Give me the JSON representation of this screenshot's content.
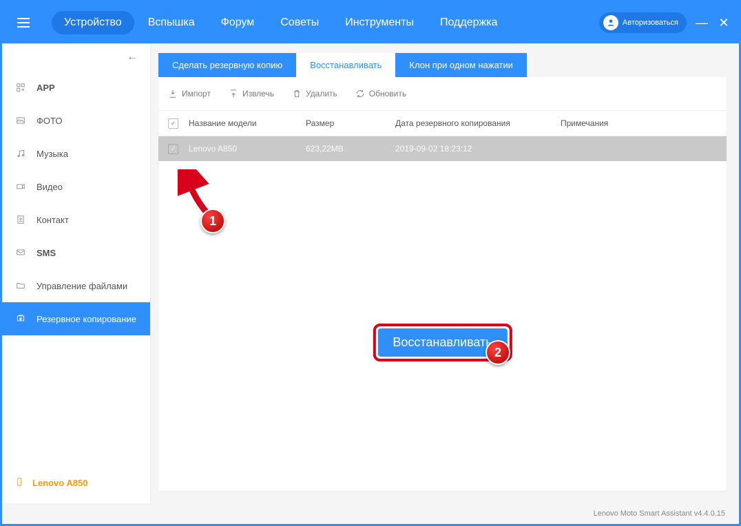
{
  "nav": {
    "items": [
      "Устройство",
      "Вспышка",
      "Форум",
      "Советы",
      "Инструменты",
      "Поддержка"
    ],
    "active": 0
  },
  "login_label": "Авторизоваться",
  "sidebar": {
    "items": [
      {
        "label": "APP",
        "icon": "apps-icon",
        "bold": true
      },
      {
        "label": "ФОТО",
        "icon": "photo-icon"
      },
      {
        "label": "Музыка",
        "icon": "music-icon"
      },
      {
        "label": "Видео",
        "icon": "video-icon"
      },
      {
        "label": "Контакт",
        "icon": "contact-icon"
      },
      {
        "label": "SMS",
        "icon": "sms-icon",
        "bold": true
      },
      {
        "label": "Управление файлами",
        "icon": "files-icon"
      },
      {
        "label": "Резервное копирование",
        "icon": "backup-icon",
        "active": true
      }
    ],
    "device": "Lenovo A850"
  },
  "tabs": {
    "items": [
      "Сделать резервную копию",
      "Восстанавливать",
      "Клон при одном нажатии"
    ],
    "active": 1
  },
  "toolbar": {
    "import": "Импорт",
    "extract": "Извлечь",
    "delete": "Удалить",
    "refresh": "Обновить"
  },
  "columns": {
    "name": "Название модели",
    "size": "Размер",
    "date": "Дата резервного копирования",
    "notes": "Примечания"
  },
  "rows": [
    {
      "name": "Lenovo A850",
      "size": "623,22MB",
      "date": "2019-09-02 18:23:12",
      "notes": "",
      "selected": true
    }
  ],
  "restore_btn": "Восстанавливать",
  "status": "Lenovo Moto Smart Assistant v4.4.0.15",
  "markers": {
    "m1": "1",
    "m2": "2"
  }
}
